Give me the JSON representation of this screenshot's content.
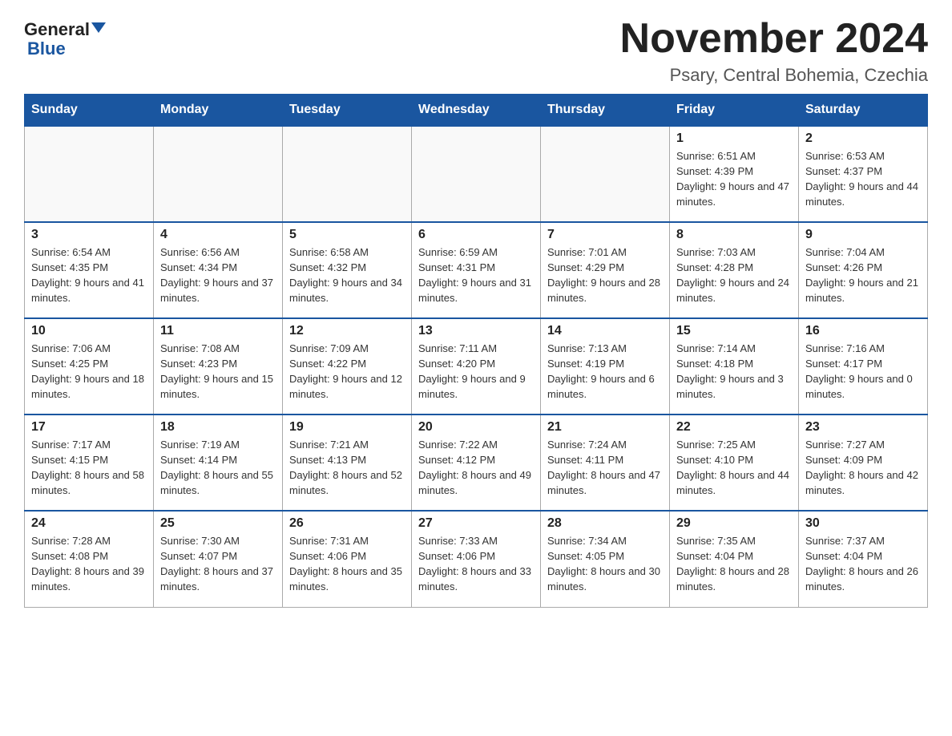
{
  "header": {
    "logo_general": "General",
    "logo_blue": "Blue",
    "month_title": "November 2024",
    "location": "Psary, Central Bohemia, Czechia"
  },
  "days_of_week": [
    "Sunday",
    "Monday",
    "Tuesday",
    "Wednesday",
    "Thursday",
    "Friday",
    "Saturday"
  ],
  "weeks": [
    [
      {
        "day": "",
        "info": ""
      },
      {
        "day": "",
        "info": ""
      },
      {
        "day": "",
        "info": ""
      },
      {
        "day": "",
        "info": ""
      },
      {
        "day": "",
        "info": ""
      },
      {
        "day": "1",
        "info": "Sunrise: 6:51 AM\nSunset: 4:39 PM\nDaylight: 9 hours and 47 minutes."
      },
      {
        "day": "2",
        "info": "Sunrise: 6:53 AM\nSunset: 4:37 PM\nDaylight: 9 hours and 44 minutes."
      }
    ],
    [
      {
        "day": "3",
        "info": "Sunrise: 6:54 AM\nSunset: 4:35 PM\nDaylight: 9 hours and 41 minutes."
      },
      {
        "day": "4",
        "info": "Sunrise: 6:56 AM\nSunset: 4:34 PM\nDaylight: 9 hours and 37 minutes."
      },
      {
        "day": "5",
        "info": "Sunrise: 6:58 AM\nSunset: 4:32 PM\nDaylight: 9 hours and 34 minutes."
      },
      {
        "day": "6",
        "info": "Sunrise: 6:59 AM\nSunset: 4:31 PM\nDaylight: 9 hours and 31 minutes."
      },
      {
        "day": "7",
        "info": "Sunrise: 7:01 AM\nSunset: 4:29 PM\nDaylight: 9 hours and 28 minutes."
      },
      {
        "day": "8",
        "info": "Sunrise: 7:03 AM\nSunset: 4:28 PM\nDaylight: 9 hours and 24 minutes."
      },
      {
        "day": "9",
        "info": "Sunrise: 7:04 AM\nSunset: 4:26 PM\nDaylight: 9 hours and 21 minutes."
      }
    ],
    [
      {
        "day": "10",
        "info": "Sunrise: 7:06 AM\nSunset: 4:25 PM\nDaylight: 9 hours and 18 minutes."
      },
      {
        "day": "11",
        "info": "Sunrise: 7:08 AM\nSunset: 4:23 PM\nDaylight: 9 hours and 15 minutes."
      },
      {
        "day": "12",
        "info": "Sunrise: 7:09 AM\nSunset: 4:22 PM\nDaylight: 9 hours and 12 minutes."
      },
      {
        "day": "13",
        "info": "Sunrise: 7:11 AM\nSunset: 4:20 PM\nDaylight: 9 hours and 9 minutes."
      },
      {
        "day": "14",
        "info": "Sunrise: 7:13 AM\nSunset: 4:19 PM\nDaylight: 9 hours and 6 minutes."
      },
      {
        "day": "15",
        "info": "Sunrise: 7:14 AM\nSunset: 4:18 PM\nDaylight: 9 hours and 3 minutes."
      },
      {
        "day": "16",
        "info": "Sunrise: 7:16 AM\nSunset: 4:17 PM\nDaylight: 9 hours and 0 minutes."
      }
    ],
    [
      {
        "day": "17",
        "info": "Sunrise: 7:17 AM\nSunset: 4:15 PM\nDaylight: 8 hours and 58 minutes."
      },
      {
        "day": "18",
        "info": "Sunrise: 7:19 AM\nSunset: 4:14 PM\nDaylight: 8 hours and 55 minutes."
      },
      {
        "day": "19",
        "info": "Sunrise: 7:21 AM\nSunset: 4:13 PM\nDaylight: 8 hours and 52 minutes."
      },
      {
        "day": "20",
        "info": "Sunrise: 7:22 AM\nSunset: 4:12 PM\nDaylight: 8 hours and 49 minutes."
      },
      {
        "day": "21",
        "info": "Sunrise: 7:24 AM\nSunset: 4:11 PM\nDaylight: 8 hours and 47 minutes."
      },
      {
        "day": "22",
        "info": "Sunrise: 7:25 AM\nSunset: 4:10 PM\nDaylight: 8 hours and 44 minutes."
      },
      {
        "day": "23",
        "info": "Sunrise: 7:27 AM\nSunset: 4:09 PM\nDaylight: 8 hours and 42 minutes."
      }
    ],
    [
      {
        "day": "24",
        "info": "Sunrise: 7:28 AM\nSunset: 4:08 PM\nDaylight: 8 hours and 39 minutes."
      },
      {
        "day": "25",
        "info": "Sunrise: 7:30 AM\nSunset: 4:07 PM\nDaylight: 8 hours and 37 minutes."
      },
      {
        "day": "26",
        "info": "Sunrise: 7:31 AM\nSunset: 4:06 PM\nDaylight: 8 hours and 35 minutes."
      },
      {
        "day": "27",
        "info": "Sunrise: 7:33 AM\nSunset: 4:06 PM\nDaylight: 8 hours and 33 minutes."
      },
      {
        "day": "28",
        "info": "Sunrise: 7:34 AM\nSunset: 4:05 PM\nDaylight: 8 hours and 30 minutes."
      },
      {
        "day": "29",
        "info": "Sunrise: 7:35 AM\nSunset: 4:04 PM\nDaylight: 8 hours and 28 minutes."
      },
      {
        "day": "30",
        "info": "Sunrise: 7:37 AM\nSunset: 4:04 PM\nDaylight: 8 hours and 26 minutes."
      }
    ]
  ]
}
